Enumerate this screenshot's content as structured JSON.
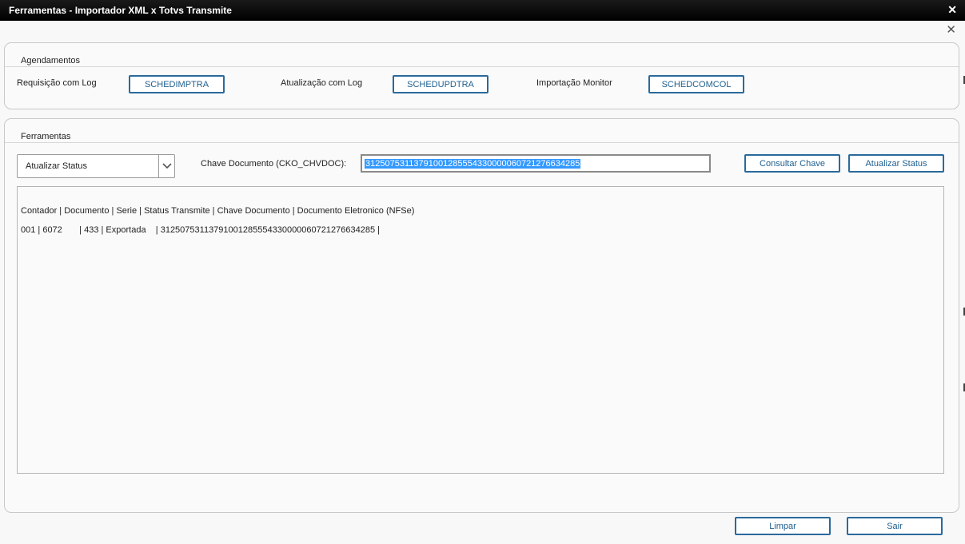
{
  "window": {
    "title": "Ferramentas - Importador XML x Totvs Transmite",
    "close_glyph": "✕",
    "dialog_close_glyph": "✕"
  },
  "agendamentos": {
    "title": "Agendamentos",
    "items": [
      {
        "label": "Requisição com Log",
        "button": "SCHEDIMPTRA"
      },
      {
        "label": "Atualização com Log",
        "button": "SCHEDUPDTRA"
      },
      {
        "label": "Importação Monitor",
        "button": "SCHEDCOMCOL"
      }
    ]
  },
  "ferramentas": {
    "title": "Ferramentas",
    "action_select": {
      "value": "Atualizar Status"
    },
    "key_label": "Chave Documento (CKO_CHVDOC):",
    "key_value": "31250753113791001285554330000060721276634285",
    "consult_button": "Consultar Chave",
    "update_button": "Atualizar Status",
    "result": {
      "header": "Contador | Documento | Serie | Status Transmite | Chave Documento | Documento Eletronico (NFSe)",
      "rows": [
        "001 | 6072       | 433 | Exportada    | 31250753113791001285554330000060721276634285 |"
      ]
    }
  },
  "footer": {
    "clear_button": "Limpar",
    "exit_button": "Sair"
  },
  "colors": {
    "accent": "#2a6a9b",
    "titlebar": "#000000",
    "selection": "#3399ff"
  },
  "icons": {
    "window_close": "close-icon",
    "dialog_close": "close-icon",
    "combo_arrow": "chevron-down-icon"
  }
}
